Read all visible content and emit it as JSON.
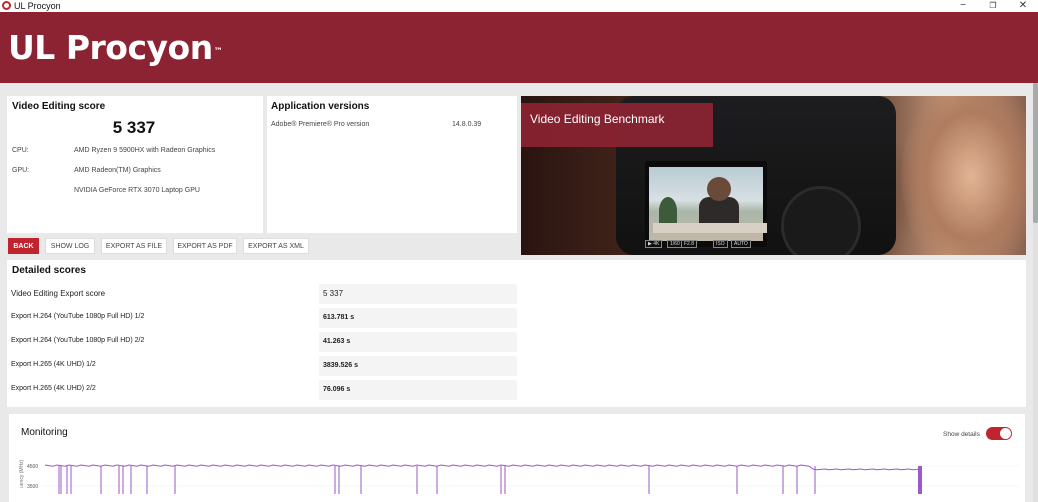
{
  "window": {
    "title": "UL Procyon",
    "minimize": "−",
    "maximize": "❐",
    "close": "✕"
  },
  "header": {
    "brand": "UL Procyon",
    "trademark": "™",
    "background_color": "#8c2332"
  },
  "score_panel": {
    "title": "Video Editing score",
    "score": "5 337",
    "cpu_label": "CPU:",
    "cpu_value": "AMD Ryzen 9 5900HX with Radeon Graphics",
    "gpu_label": "GPU:",
    "gpu_value_1": "AMD Radeon(TM) Graphics",
    "gpu_value_2": "NVIDIA GeForce RTX 3070 Laptop GPU"
  },
  "app_versions": {
    "title": "Application versions",
    "app_name": "Adobe® Premiere® Pro version",
    "app_version": "14.8.0.39"
  },
  "hero": {
    "label": "Video Editing Benchmark",
    "screen_tags": [
      "▶ 4K",
      "1/60",
      "F2.8",
      "ISO",
      "AUTO"
    ]
  },
  "toolbar": {
    "back": "BACK",
    "show_log": "SHOW LOG",
    "export_file": "EXPORT AS FILE",
    "export_pdf": "EXPORT AS PDF",
    "export_xml": "EXPORT AS XML",
    "accent_color": "#c0252f"
  },
  "detailed": {
    "title": "Detailed scores",
    "rows": [
      {
        "label": "Video Editing Export score",
        "value": "5 337"
      },
      {
        "label": "Export H.264 (YouTube 1080p Full HD) 1/2",
        "value": "613.781 s"
      },
      {
        "label": "Export H.264 (YouTube 1080p Full HD) 2/2",
        "value": "41.263 s"
      },
      {
        "label": "Export H.265 (4K UHD) 1/2",
        "value": "3839.526 s"
      },
      {
        "label": "Export H.265 (4K UHD) 2/2",
        "value": "76.096 s"
      }
    ]
  },
  "monitoring": {
    "title": "Monitoring",
    "show_details_label": "Show details",
    "show_details_on": true,
    "y_axis_label": "uency (MHz)",
    "y_ticks": [
      "4500",
      "3500"
    ],
    "line_color": "#9b59c9"
  }
}
